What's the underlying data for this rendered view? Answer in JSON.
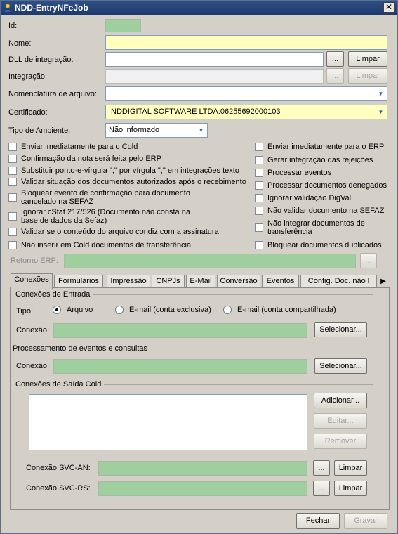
{
  "window": {
    "title": "NDD-EntryNFeJob",
    "close_glyph": "✕"
  },
  "form": {
    "id_label": "Id:",
    "nome_label": "Nome:",
    "dll_label": "DLL de integração:",
    "dll_browse": "...",
    "dll_clear": "Limpar",
    "integracao_label": "Integração:",
    "integracao_browse": "...",
    "integracao_clear": "Limpar",
    "nomenclatura_label": "Nomenclatura de arquivo:",
    "certificado_label": "Certificado:",
    "certificado_value": "NDDIGITAL SOFTWARE LTDA:06255692000103",
    "ambiente_label": "Tipo de Ambiente:",
    "ambiente_value": "Não informado",
    "retorno_label": "Retorno ERP:",
    "retorno_browse": "..."
  },
  "checks_left": [
    {
      "label": "Enviar imediatamente para o Cold"
    },
    {
      "label": "Confirmação da nota será feita pelo ERP"
    },
    {
      "label": "Substituir ponto-e-vírgula \";\" por vírgula \",\" em integrações texto"
    },
    {
      "label": "Validar situação dos documentos autorizados após o recebimento"
    },
    {
      "label": "Bloquear evento de confirmação para documento\ncancelado na SEFAZ"
    },
    {
      "label": "Ignorar cStat 217/526 (Documento não consta na\nbase de dados da Sefaz)"
    },
    {
      "label": "Validar se o conteúdo do arquivo condiz com a assinatura"
    },
    {
      "label": "Não inserir em Cold documentos de transferência"
    }
  ],
  "checks_right": [
    {
      "label": "Enviar imediatamente para o ERP"
    },
    {
      "label": "Gerar integração das rejeições"
    },
    {
      "label": "Processar eventos"
    },
    {
      "label": "Processar documentos denegados"
    },
    {
      "label": "Ignorar validação DigVal"
    },
    {
      "label": "Não validar documento na SEFAZ"
    },
    {
      "label": "Não integrar documentos de\ntransferência"
    },
    {
      "label": "Bloquear documentos duplicados"
    }
  ],
  "tabs": [
    "Conexões",
    "Formulários",
    "Impressão",
    "CNPJs",
    "E-Mail",
    "Conversão",
    "Eventos",
    "Config. Doc. não l"
  ],
  "tab_scroll": "▶",
  "conexoes": {
    "entrada_group": "Conexões de Entrada",
    "tipo_label": "Tipo:",
    "radio_arquivo": "Arquivo",
    "radio_email_excl": "E-mail (conta exclusiva)",
    "radio_email_comp": "E-mail (conta compartilhada)",
    "conexao_label": "Conexão:",
    "selecionar": "Selecionar...",
    "eventos_group": "Processamento de eventos e consultas",
    "conexao2_label": "Conexão:",
    "selecionar2": "Selecionar...",
    "cold_group": "Conexões de Saída Cold",
    "adicionar": "Adicionar...",
    "editar": "Editar...",
    "remover": "Remover",
    "svcan_label": "Conexão SVC-AN:",
    "svcan_browse": "...",
    "svcan_clear": "Limpar",
    "svcrs_label": "Conexão SVC-RS:",
    "svcrs_browse": "...",
    "svcrs_clear": "Limpar"
  },
  "footer": {
    "fechar": "Fechar",
    "gravar": "Gravar"
  }
}
